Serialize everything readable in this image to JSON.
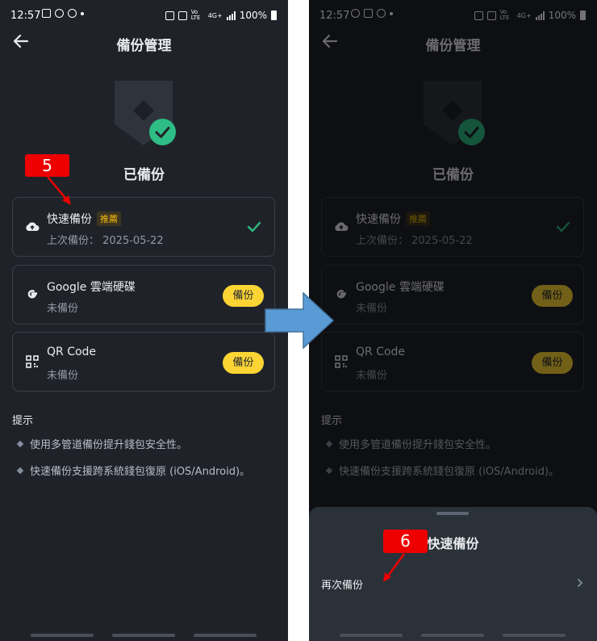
{
  "status_bar": {
    "time": "12:57",
    "battery": "100%",
    "network": "4G+",
    "volte": "Vo LTE"
  },
  "header": {
    "title": "備份管理"
  },
  "status": {
    "title": "已備份"
  },
  "options": [
    {
      "name": "快速備份",
      "badge": "推薦",
      "sub": "上次備份： 2025-05-22"
    },
    {
      "name": "Google 雲端硬碟",
      "sub": "未備份",
      "button": "備份"
    },
    {
      "name": "QR Code",
      "sub": "未備份",
      "button": "備份"
    }
  ],
  "tips": {
    "title": "提示",
    "items": [
      "使用多管道備份提升錢包安全性。",
      "快速備份支援跨系統錢包復原 (iOS/Android)。"
    ]
  },
  "sheet": {
    "title": "快速備份",
    "row_label": "再次備份"
  },
  "annotations": {
    "step5": "5",
    "step6": "6"
  },
  "colors": {
    "background": "#1f2329",
    "accent_yellow": "#fcd535",
    "success_green": "#2ebd85",
    "annotation_red": "#ee0000",
    "arrow_blue": "#5b9bd5"
  }
}
